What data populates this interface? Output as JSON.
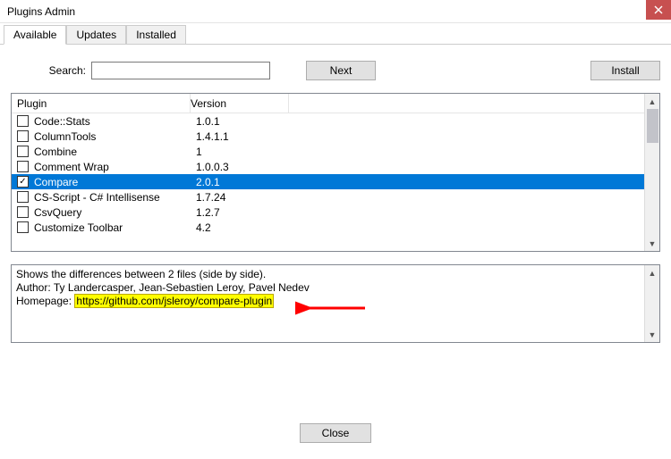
{
  "window": {
    "title": "Plugins Admin"
  },
  "tabs": {
    "available": "Available",
    "updates": "Updates",
    "installed": "Installed"
  },
  "toolbar": {
    "search_label": "Search:",
    "search_value": "",
    "next_label": "Next",
    "install_label": "Install"
  },
  "columns": {
    "plugin": "Plugin",
    "version": "Version"
  },
  "plugins": [
    {
      "name": "Code::Stats",
      "version": "1.0.1",
      "checked": false,
      "selected": false
    },
    {
      "name": "ColumnTools",
      "version": "1.4.1.1",
      "checked": false,
      "selected": false
    },
    {
      "name": "Combine",
      "version": "1",
      "checked": false,
      "selected": false
    },
    {
      "name": "Comment Wrap",
      "version": "1.0.0.3",
      "checked": false,
      "selected": false
    },
    {
      "name": "Compare",
      "version": "2.0.1",
      "checked": true,
      "selected": true
    },
    {
      "name": "CS-Script - C# Intellisense",
      "version": "1.7.24",
      "checked": false,
      "selected": false
    },
    {
      "name": "CsvQuery",
      "version": "1.2.7",
      "checked": false,
      "selected": false
    },
    {
      "name": "Customize Toolbar",
      "version": "4.2",
      "checked": false,
      "selected": false
    }
  ],
  "description": {
    "line1": "Shows the differences between 2 files (side by side).",
    "author_label": "Author:",
    "author_value": "Ty Landercasper, Jean-Sebastien Leroy, Pavel Nedev",
    "homepage_label": "Homepage:",
    "homepage_value": "https://github.com/jsleroy/compare-plugin"
  },
  "footer": {
    "close_label": "Close"
  }
}
